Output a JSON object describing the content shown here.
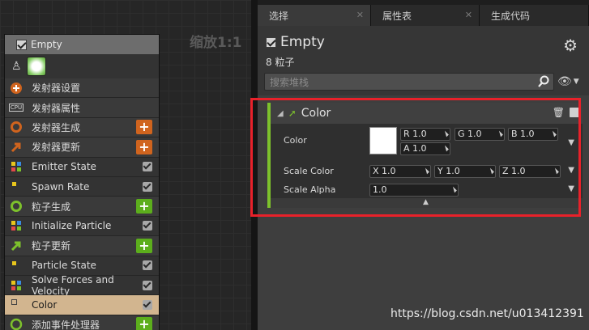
{
  "graph": {
    "zoom_label": "缩放1:1"
  },
  "emitter": {
    "title": "Empty",
    "modules": [
      {
        "label": "发射器设置",
        "kind": "section",
        "icon": "emitter-settings-icon",
        "control": "none"
      },
      {
        "label": "发射器属性",
        "kind": "section",
        "icon": "cpu-icon",
        "control": "none"
      },
      {
        "label": "发射器生成",
        "kind": "section",
        "icon": "spawn-ring-icon",
        "control": "plus-orange"
      },
      {
        "label": "发射器更新",
        "kind": "section",
        "icon": "update-arrow-icon",
        "control": "plus-orange"
      },
      {
        "label": "Emitter State",
        "kind": "sub",
        "icon": "dots-icon",
        "control": "checkbox"
      },
      {
        "label": "Spawn Rate",
        "kind": "sub",
        "icon": "dot-icon",
        "control": "checkbox"
      },
      {
        "label": "粒子生成",
        "kind": "section",
        "icon": "spawn-ring-green-icon",
        "control": "plus-green"
      },
      {
        "label": "Initialize Particle",
        "kind": "sub",
        "icon": "dots-icon",
        "control": "checkbox"
      },
      {
        "label": "粒子更新",
        "kind": "section",
        "icon": "update-arrow-green-icon",
        "control": "plus-green"
      },
      {
        "label": "Particle State",
        "kind": "sub",
        "icon": "dot-icon",
        "control": "checkbox"
      },
      {
        "label": "Solve Forces and Velocity",
        "kind": "sub",
        "icon": "dots-icon",
        "control": "checkbox"
      },
      {
        "label": "Color",
        "kind": "selected",
        "icon": "empty-square-icon",
        "control": "checkbox"
      },
      {
        "label": "添加事件处理器",
        "kind": "section",
        "icon": "event-icon",
        "control": "plus-green"
      }
    ]
  },
  "tabs": [
    {
      "label": "选择",
      "active": true
    },
    {
      "label": "属性表",
      "active": false
    },
    {
      "label": "生成代码",
      "active": false
    }
  ],
  "details": {
    "title": "Empty",
    "count": "8 粒子",
    "search_placeholder": "搜索堆栈",
    "module": {
      "title": "Color",
      "rows": [
        {
          "label": "Color",
          "fields": [
            "R 1.0",
            "G 1.0",
            "B 1.0",
            "A 1.0"
          ]
        },
        {
          "label": "Scale Color",
          "fields": [
            "X 1.0",
            "Y 1.0",
            "Z 1.0"
          ]
        },
        {
          "label": "Scale Alpha",
          "fields": [
            "1.0"
          ]
        }
      ]
    }
  },
  "watermark": "https://blog.csdn.net/u013412391",
  "colors": {
    "accent_green": "#7dc12c",
    "accent_orange": "#d0641e",
    "highlight_red": "#e8212a",
    "selected_row": "#d2b58f"
  }
}
